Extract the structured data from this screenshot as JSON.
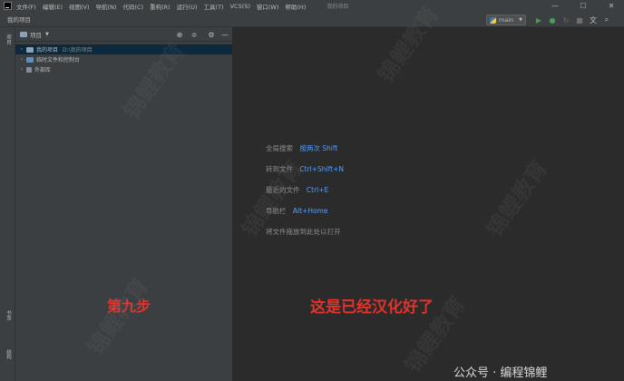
{
  "menu": [
    "文件(F)",
    "编辑(E)",
    "视图(V)",
    "导航(N)",
    "代码(C)",
    "重构(R)",
    "运行(U)",
    "工具(T)",
    "VCS(S)",
    "窗口(W)",
    "帮助(H)"
  ],
  "window_title": "我的项目",
  "window_controls": {
    "minimize": "—",
    "maximize": "☐",
    "close": "✕"
  },
  "breadcrumb": "我的项目",
  "branch": "main",
  "left_strip": {
    "project": "项目",
    "bookmarks": "书签",
    "structure": "结构"
  },
  "project_panel": {
    "title": "项目",
    "tree": [
      {
        "label": "我的项目",
        "path": "D:\\我的项目",
        "selected": true
      },
      {
        "label": "临时文件和控制台",
        "path": "",
        "selected": false
      },
      {
        "label": "外部库",
        "path": "",
        "selected": false
      }
    ]
  },
  "editor_hints": [
    {
      "label": "全局搜索",
      "key": "按两次 Shift"
    },
    {
      "label": "转到文件",
      "key": "Ctrl+Shift+N"
    },
    {
      "label": "最近的文件",
      "key": "Ctrl+E"
    },
    {
      "label": "导航栏",
      "key": "Alt+Home"
    },
    {
      "label": "将文件拖放到此处以打开",
      "key": ""
    }
  ],
  "annotations": {
    "step": "第九步",
    "note": "这是已经汉化好了"
  },
  "watermark": {
    "footer": "公众号 · 编程锦鲤",
    "diagonal": "锦鲤教育"
  }
}
